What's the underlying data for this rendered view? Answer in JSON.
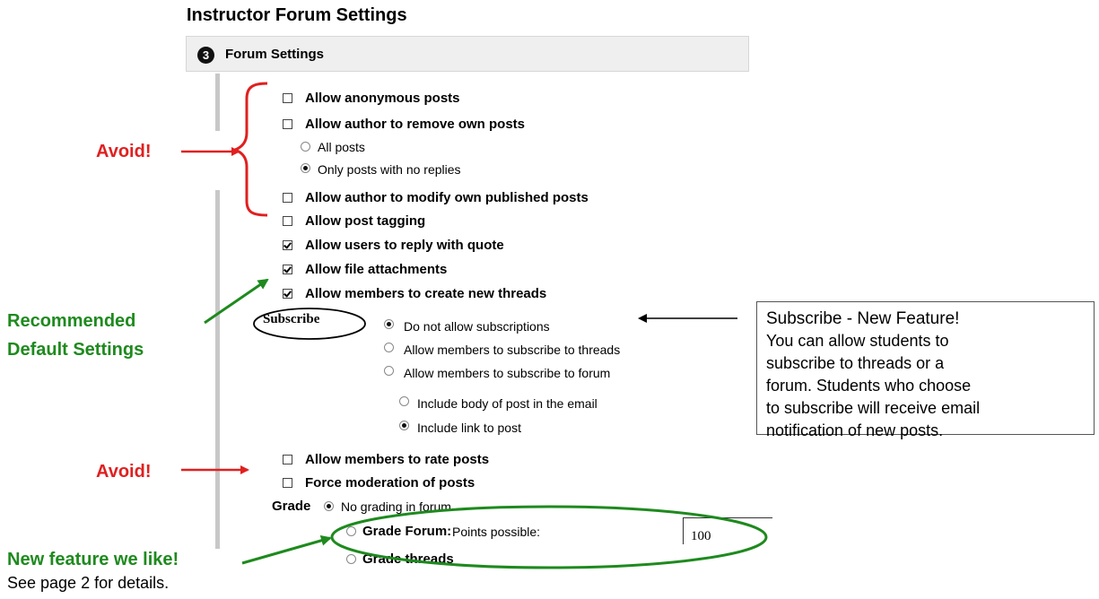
{
  "page": {
    "title": "Instructor Forum Settings"
  },
  "section": {
    "step": "3",
    "title": "Forum Settings"
  },
  "options": {
    "anonymous": {
      "label": "Allow anonymous posts",
      "checked": false
    },
    "remove_own": {
      "label": "Allow author to remove own posts",
      "checked": false
    },
    "remove_all": {
      "label": "All posts",
      "selected": false
    },
    "remove_no_replies": {
      "label": "Only posts with no replies",
      "selected": true
    },
    "modify_own": {
      "label": "Allow author to modify own published posts",
      "checked": false
    },
    "tagging": {
      "label": "Allow post tagging",
      "checked": false
    },
    "reply_quote": {
      "label": "Allow users to reply with quote",
      "checked": true
    },
    "file_attach": {
      "label": "Allow file attachments",
      "checked": true
    },
    "new_threads": {
      "label": "Allow members to create new threads",
      "checked": true
    },
    "rate_posts": {
      "label": "Allow members to rate posts",
      "checked": false
    },
    "force_moderation": {
      "label": "Force moderation of posts",
      "checked": false
    }
  },
  "subscribe": {
    "label": "Subscribe",
    "none": {
      "label": "Do not allow subscriptions",
      "selected": true
    },
    "threads": {
      "label": "Allow members to subscribe to threads",
      "selected": false
    },
    "forum": {
      "label": "Allow members to subscribe to forum",
      "selected": false
    },
    "include_body": {
      "label": "Include body of post in the email",
      "selected": false
    },
    "include_link": {
      "label": "Include link to post",
      "selected": true
    }
  },
  "grade": {
    "label": "Grade",
    "no_grading": {
      "label": "No grading in forum",
      "selected": true
    },
    "grade_forum": {
      "label": "Grade Forum:",
      "points_label": "Points possible:",
      "points_value": "100",
      "selected": false
    },
    "grade_threads": {
      "label": "Grade threads",
      "selected": false
    }
  },
  "annotations": {
    "avoid_1": "Avoid!",
    "avoid_2": "Avoid!",
    "recommended_line1": "Recommended",
    "recommended_line2": "Default Settings",
    "new_feature": "New feature we like!",
    "see_page": "See page 2 for details."
  },
  "callout": {
    "title": "Subscribe - New Feature!",
    "lines": [
      "You can allow students to",
      "subscribe to threads or a",
      "forum. Students who choose",
      "to subscribe will receive email",
      "notification of new posts."
    ]
  },
  "colors": {
    "red": "#e02020",
    "green": "#1e8a1e",
    "section_bar": "#efefef"
  }
}
